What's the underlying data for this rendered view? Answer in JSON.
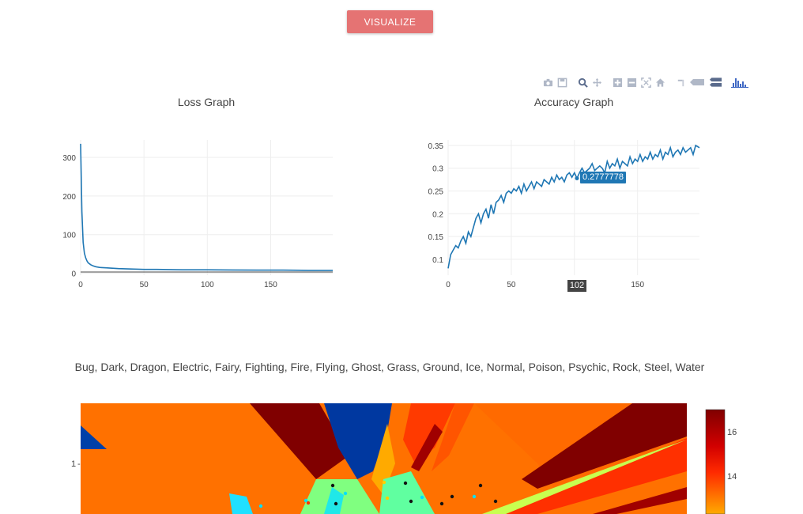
{
  "visualize_button": {
    "label": "VISUALIZE"
  },
  "modebar_icons": [
    "camera-icon",
    "save-icon",
    "zoom-icon",
    "pan-icon",
    "zoom-in-icon",
    "zoom-out-icon",
    "autoscale-icon",
    "reset-axes-icon",
    "spike-lines-icon",
    "hover-closest-icon",
    "hover-compare-icon",
    "plotly-logo-icon"
  ],
  "colors": {
    "button": "#e57373",
    "line": "#1f77b4",
    "grid": "#eeeeee",
    "tooltip": "#1f77b4"
  },
  "loss_graph": {
    "title": "Loss Graph"
  },
  "accuracy_graph": {
    "title": "Accuracy Graph",
    "hover_value": "0.2777778",
    "hover_x": "102"
  },
  "classes_line": "Bug, Dark, Dragon, Electric, Fairy, Fighting, Fire, Flying, Ghost, Grass, Ground, Ice, Normal, Poison, Psychic, Rock, Steel, Water",
  "chart_data": [
    {
      "type": "line",
      "title": "Loss Graph",
      "xlim": [
        0,
        199
      ],
      "ylim": [
        -5,
        345
      ],
      "x_ticks": [
        "0",
        "50",
        "100",
        "150"
      ],
      "y_ticks": [
        "0",
        "100",
        "200",
        "300"
      ],
      "series": [
        {
          "x": [
            0,
            1,
            2,
            3,
            4,
            5,
            6,
            8,
            10,
            12,
            15,
            20,
            25,
            30,
            40,
            50,
            60,
            80,
            100,
            120,
            140,
            160,
            180,
            199
          ],
          "y": [
            335,
            160,
            80,
            52,
            40,
            32,
            27,
            22,
            19,
            17,
            15,
            14,
            13,
            12,
            11,
            10,
            10,
            9,
            9,
            8.5,
            8,
            8,
            7.5,
            7.5
          ]
        }
      ]
    },
    {
      "type": "line",
      "title": "Accuracy Graph",
      "xlim": [
        0,
        199
      ],
      "ylim": [
        0.065,
        0.362
      ],
      "x_ticks": [
        "0",
        "50",
        "100",
        "150"
      ],
      "y_ticks": [
        "0.1",
        "0.15",
        "0.2",
        "0.25",
        "0.3",
        "0.35"
      ],
      "series": [
        {
          "x": [
            0,
            2,
            4,
            6,
            8,
            10,
            12,
            14,
            16,
            18,
            20,
            22,
            24,
            26,
            28,
            30,
            32,
            34,
            36,
            38,
            40,
            42,
            44,
            46,
            48,
            50,
            52,
            54,
            56,
            58,
            60,
            62,
            64,
            66,
            68,
            70,
            72,
            74,
            76,
            78,
            80,
            82,
            84,
            86,
            88,
            90,
            92,
            94,
            96,
            98,
            100,
            102,
            104,
            106,
            108,
            110,
            112,
            114,
            116,
            118,
            120,
            122,
            124,
            126,
            128,
            130,
            132,
            134,
            136,
            138,
            140,
            142,
            144,
            146,
            148,
            150,
            152,
            154,
            156,
            158,
            160,
            162,
            164,
            166,
            168,
            170,
            172,
            174,
            176,
            178,
            180,
            182,
            184,
            186,
            188,
            190,
            192,
            194,
            196,
            199
          ],
          "y": [
            0.08,
            0.11,
            0.12,
            0.13,
            0.125,
            0.14,
            0.15,
            0.135,
            0.16,
            0.15,
            0.17,
            0.19,
            0.2,
            0.18,
            0.2,
            0.21,
            0.19,
            0.22,
            0.2,
            0.225,
            0.23,
            0.24,
            0.225,
            0.245,
            0.25,
            0.245,
            0.255,
            0.25,
            0.26,
            0.245,
            0.265,
            0.25,
            0.26,
            0.27,
            0.255,
            0.27,
            0.265,
            0.26,
            0.275,
            0.27,
            0.265,
            0.28,
            0.27,
            0.285,
            0.275,
            0.28,
            0.27,
            0.285,
            0.29,
            0.28,
            0.29,
            0.2777778,
            0.29,
            0.3,
            0.29,
            0.295,
            0.3,
            0.31,
            0.295,
            0.3,
            0.305,
            0.3,
            0.29,
            0.315,
            0.3,
            0.31,
            0.305,
            0.32,
            0.3,
            0.315,
            0.31,
            0.305,
            0.325,
            0.31,
            0.32,
            0.315,
            0.33,
            0.315,
            0.325,
            0.32,
            0.335,
            0.32,
            0.33,
            0.325,
            0.34,
            0.32,
            0.335,
            0.33,
            0.345,
            0.325,
            0.335,
            0.34,
            0.33,
            0.345,
            0.335,
            0.34,
            0.345,
            0.33,
            0.35,
            0.345
          ]
        }
      ]
    },
    {
      "type": "heatmap",
      "y_ticks": [
        "1"
      ],
      "colorbar_ticks": [
        "16",
        "14"
      ],
      "colorscale": "jet"
    }
  ]
}
